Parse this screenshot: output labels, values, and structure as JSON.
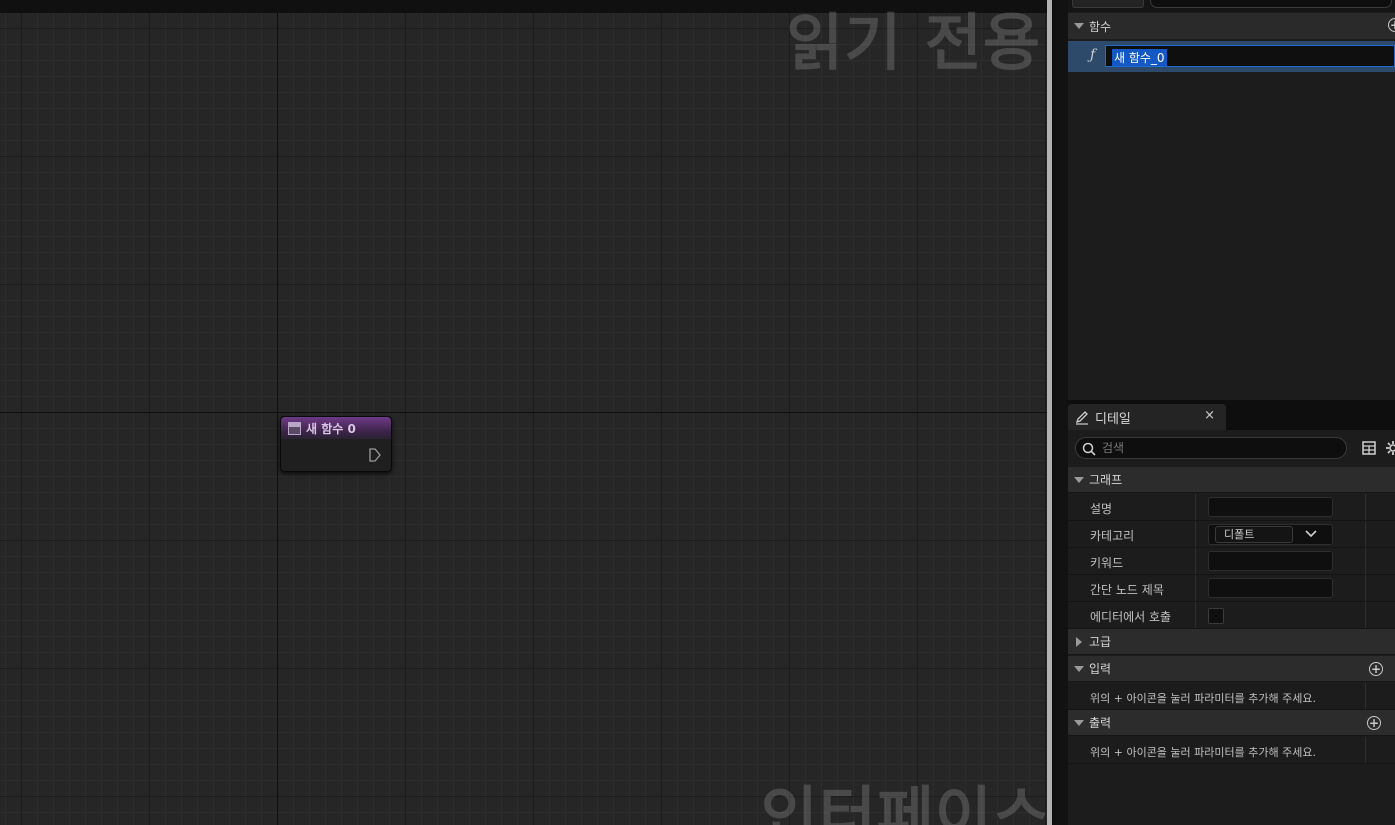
{
  "graph": {
    "watermark_top": "읽기 전용",
    "watermark_bottom": "인터페이스",
    "node": {
      "title": "새 함수 0"
    }
  },
  "functions_panel": {
    "section_title": "함수",
    "items": [
      {
        "icon": "function-icon",
        "glyph": "ƒ",
        "name_editing": "새 함수_0"
      }
    ]
  },
  "details": {
    "tab_title": "디테일",
    "close_glyph": "×",
    "search_placeholder": "검색",
    "graph_category": "그래프",
    "props": {
      "description": "설명",
      "category": "카테고리",
      "category_value": "디폴트",
      "keywords": "키워드",
      "compact_title": "간단 노드 제목",
      "call_in_editor": "에디터에서 호출"
    },
    "advanced_category": "고급",
    "inputs_category": "입력",
    "inputs_hint": "위의 + 아이콘을 눌러 파라미터를 추가해 주세요.",
    "outputs_category": "출력",
    "outputs_hint": "위의 + 아이콘을 눌러 파라미터를 추가해 주세요."
  },
  "colors": {
    "selection": "#1358c4",
    "function_row": "#2d4a6b",
    "node_header": "#6e3a86"
  }
}
